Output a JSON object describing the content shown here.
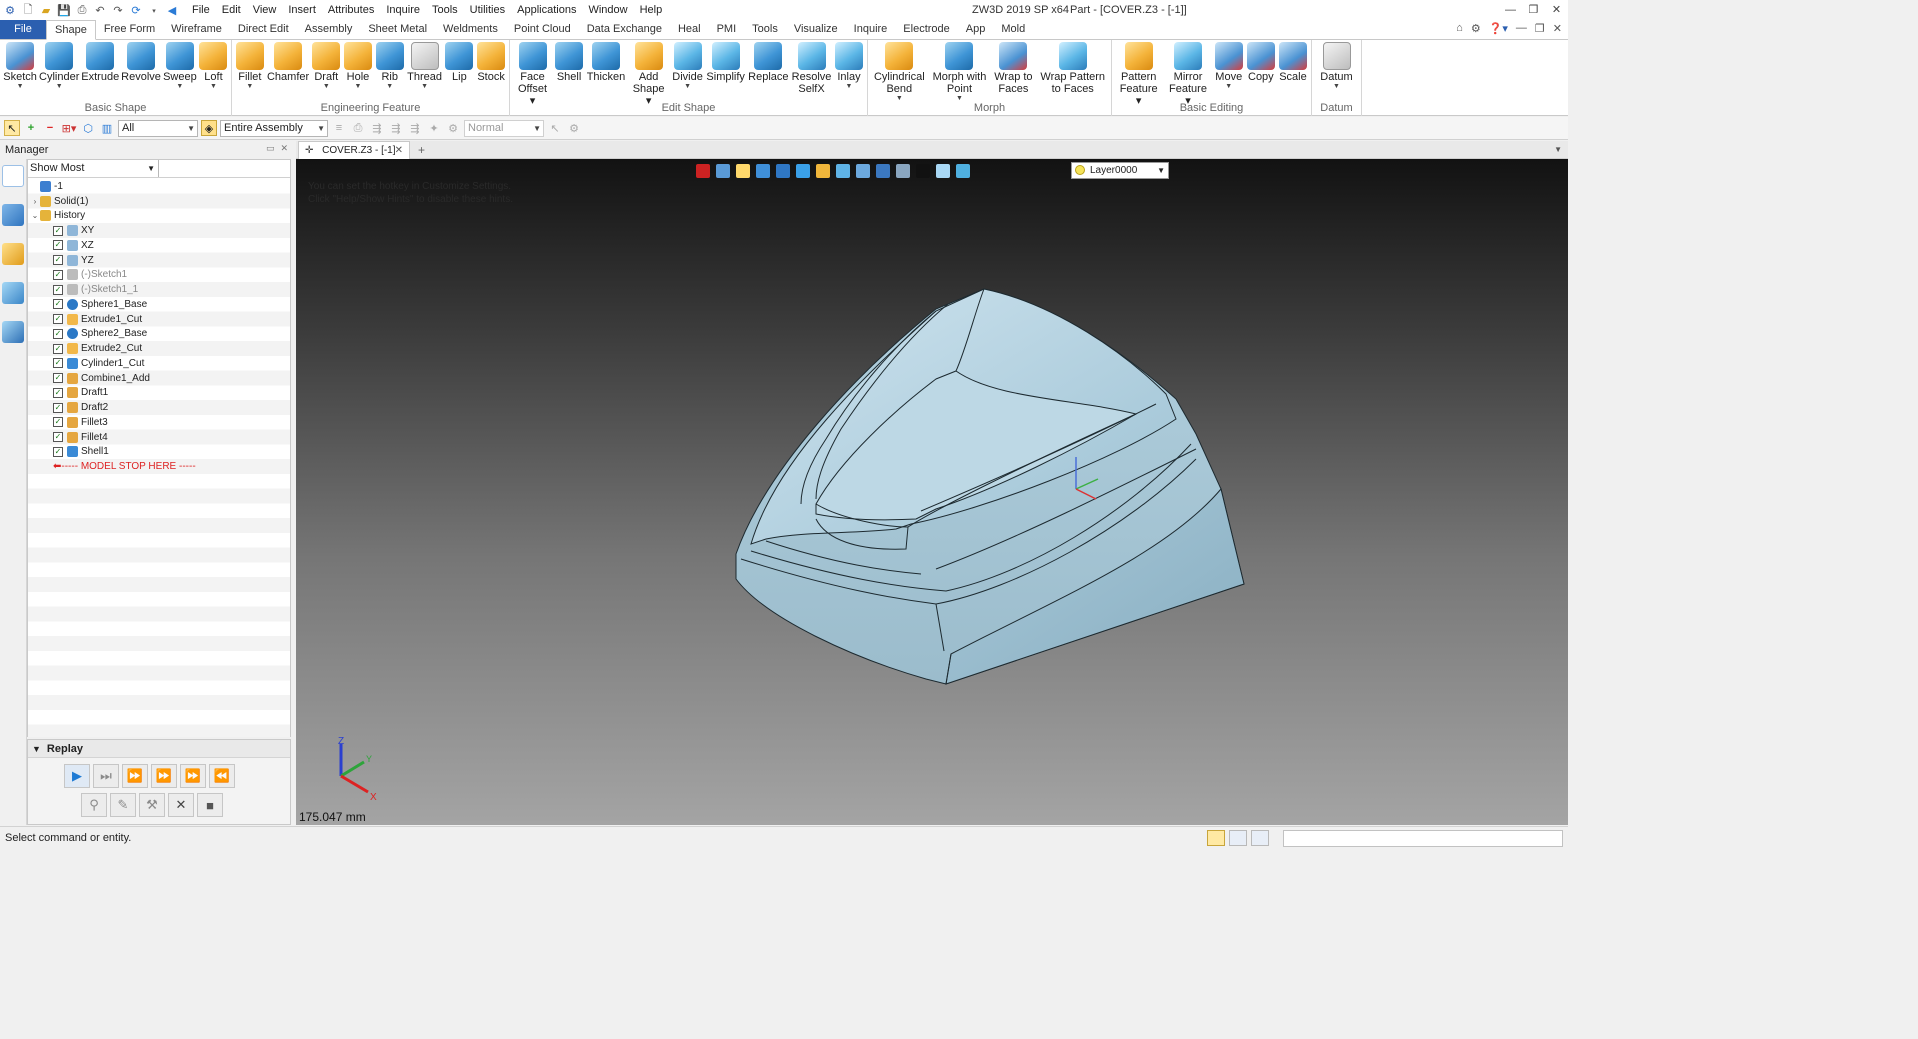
{
  "window": {
    "title": "ZW3D 2019 SP x64",
    "doc_title": "Part - [COVER.Z3 - [-1]]"
  },
  "menubar": [
    "File",
    "Edit",
    "View",
    "Insert",
    "Attributes",
    "Inquire",
    "Tools",
    "Utilities",
    "Applications",
    "Window",
    "Help"
  ],
  "ribbon_tabs": [
    "File",
    "Shape",
    "Free Form",
    "Wireframe",
    "Direct Edit",
    "Assembly",
    "Sheet Metal",
    "Weldments",
    "Point Cloud",
    "Data Exchange",
    "Heal",
    "PMI",
    "Tools",
    "Visualize",
    "Inquire",
    "Electrode",
    "App",
    "Mold"
  ],
  "active_tab": "Shape",
  "ribbon_groups": [
    {
      "label": "Basic Shape",
      "buttons": [
        {
          "label": "Sketch",
          "dd": true,
          "color": "red"
        },
        {
          "label": "Cylinder",
          "dd": true,
          "color": "blue"
        },
        {
          "label": "Extrude",
          "dd": false,
          "color": "blue"
        },
        {
          "label": "Revolve",
          "dd": false,
          "color": "blue"
        },
        {
          "label": "Sweep",
          "dd": true,
          "color": "blue"
        },
        {
          "label": "Loft",
          "dd": true,
          "color": "orange"
        }
      ]
    },
    {
      "label": "Engineering Feature",
      "buttons": [
        {
          "label": "Fillet",
          "dd": true,
          "color": "orange"
        },
        {
          "label": "Chamfer",
          "dd": false,
          "color": "orange"
        },
        {
          "label": "Draft",
          "dd": true,
          "color": "orange"
        },
        {
          "label": "Hole",
          "dd": true,
          "color": "orange"
        },
        {
          "label": "Rib",
          "dd": true,
          "color": "blue"
        },
        {
          "label": "Thread",
          "dd": true,
          "color": "grey"
        },
        {
          "label": "Lip",
          "dd": false,
          "color": "blue"
        },
        {
          "label": "Stock",
          "dd": false,
          "color": "orange"
        }
      ]
    },
    {
      "label": "Edit Shape",
      "buttons": [
        {
          "label": "Face\nOffset ▾",
          "dd": false,
          "color": "blue"
        },
        {
          "label": "Shell",
          "dd": false,
          "color": "blue"
        },
        {
          "label": "Thicken",
          "dd": false,
          "color": "blue"
        },
        {
          "label": "Add\nShape ▾",
          "dd": false,
          "color": "orange"
        },
        {
          "label": "Divide",
          "dd": true,
          "color": "teal"
        },
        {
          "label": "Simplify",
          "dd": false,
          "color": "teal"
        },
        {
          "label": "Replace",
          "dd": false,
          "color": "blue"
        },
        {
          "label": "Resolve\nSelfX",
          "dd": false,
          "color": "teal"
        },
        {
          "label": "Inlay",
          "dd": true,
          "color": "teal"
        }
      ]
    },
    {
      "label": "Morph",
      "buttons": [
        {
          "label": "Cylindrical\nBend",
          "dd": true,
          "color": "orange"
        },
        {
          "label": "Morph with\nPoint",
          "dd": true,
          "color": "blue"
        },
        {
          "label": "Wrap to\nFaces",
          "dd": false,
          "color": "red"
        },
        {
          "label": "Wrap Pattern\nto Faces",
          "dd": false,
          "color": "teal"
        }
      ]
    },
    {
      "label": "Basic Editing",
      "buttons": [
        {
          "label": "Pattern\nFeature ▾",
          "dd": false,
          "color": "orange"
        },
        {
          "label": "Mirror\nFeature ▾",
          "dd": false,
          "color": "teal"
        },
        {
          "label": "Move",
          "dd": true,
          "color": "red"
        },
        {
          "label": "Copy",
          "dd": false,
          "color": "red"
        },
        {
          "label": "Scale",
          "dd": false,
          "color": "red"
        }
      ]
    },
    {
      "label": "Datum",
      "buttons": [
        {
          "label": "Datum",
          "dd": true,
          "color": "grey"
        }
      ]
    }
  ],
  "toolbar2": {
    "filter_value": "All",
    "scope_value": "Entire Assembly",
    "render_value": "Normal"
  },
  "manager": {
    "title": "Manager",
    "filter": "Show Most",
    "tree": [
      {
        "label": "-1",
        "level": 0,
        "toggle": "",
        "check": false,
        "icon": "assembly-icon",
        "dim": false
      },
      {
        "label": "Solid(1)",
        "level": 0,
        "toggle": "›",
        "check": false,
        "icon": "folder-icon",
        "dim": false
      },
      {
        "label": "History",
        "level": 0,
        "toggle": "⌄",
        "check": false,
        "icon": "folder-icon",
        "dim": false
      },
      {
        "label": "XY",
        "level": 1,
        "check": true,
        "icon": "plane-icon",
        "dim": false
      },
      {
        "label": "XZ",
        "level": 1,
        "check": true,
        "icon": "plane-icon",
        "dim": false
      },
      {
        "label": "YZ",
        "level": 1,
        "check": true,
        "icon": "plane-icon",
        "dim": false
      },
      {
        "label": "(-)Sketch1",
        "level": 1,
        "check": true,
        "icon": "sketch-icon",
        "dim": true
      },
      {
        "label": "(-)Sketch1_1",
        "level": 1,
        "check": true,
        "icon": "sketch-icon",
        "dim": true
      },
      {
        "label": "Sphere1_Base",
        "level": 1,
        "check": true,
        "icon": "sphere-icon",
        "dim": false
      },
      {
        "label": "Extrude1_Cut",
        "level": 1,
        "check": true,
        "icon": "extrude-icon",
        "dim": false
      },
      {
        "label": "Sphere2_Base",
        "level": 1,
        "check": true,
        "icon": "sphere-icon",
        "dim": false
      },
      {
        "label": "Extrude2_Cut",
        "level": 1,
        "check": true,
        "icon": "extrude-icon",
        "dim": false
      },
      {
        "label": "Cylinder1_Cut",
        "level": 1,
        "check": true,
        "icon": "cylinder-icon",
        "dim": false
      },
      {
        "label": "Combine1_Add",
        "level": 1,
        "check": true,
        "icon": "combine-icon",
        "dim": false
      },
      {
        "label": "Draft1",
        "level": 1,
        "check": true,
        "icon": "draft-icon",
        "dim": false
      },
      {
        "label": "Draft2",
        "level": 1,
        "check": true,
        "icon": "draft-icon",
        "dim": false
      },
      {
        "label": "Fillet3",
        "level": 1,
        "check": true,
        "icon": "fillet-icon",
        "dim": false
      },
      {
        "label": "Fillet4",
        "level": 1,
        "check": true,
        "icon": "fillet-icon",
        "dim": false
      },
      {
        "label": "Shell1",
        "level": 1,
        "check": true,
        "icon": "shell-icon",
        "dim": false
      }
    ],
    "stop_label": "----- MODEL STOP HERE -----"
  },
  "replay": {
    "title": "Replay"
  },
  "doc_tab": {
    "label": "COVER.Z3 - [-1]"
  },
  "viewport": {
    "hint_line1": "You can set the hotkey in Customize Settings.",
    "hint_line2": "Click \"Help/Show Hints\" to disable these hints.",
    "layer": "Layer0000",
    "scale_readout": "175.047 mm",
    "axis_x": "X",
    "axis_y": "Y",
    "axis_z": "Z"
  },
  "status": {
    "text": "Select command or entity."
  },
  "colors": {
    "accent": "#2b5fb0",
    "model": "#9ec4d6",
    "stop": "#d22222"
  }
}
